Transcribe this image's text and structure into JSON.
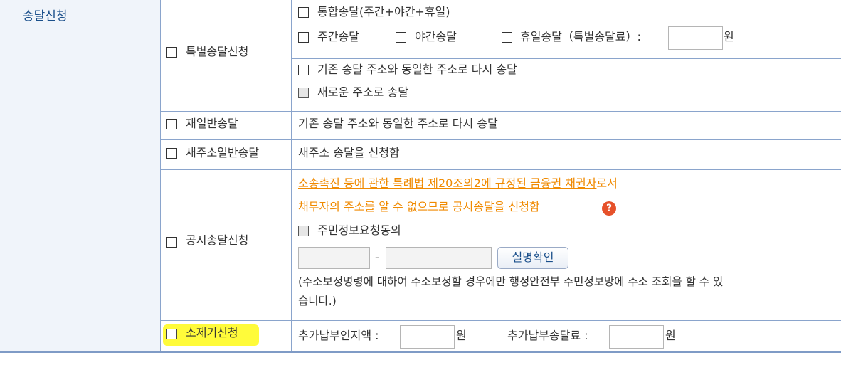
{
  "section_label": "송달신청",
  "special": {
    "label": "특별송달신청",
    "options": {
      "integrated": "통합송달(주간+야간+휴일)",
      "day": "주간송달",
      "night": "야간송달",
      "holiday": "휴일송달（특별송달료）:",
      "holiday_fee_unit": "원",
      "same_address": "기존 송달 주소와 동일한 주소로 다시 송달",
      "new_address": "새로운 주소로 송달"
    }
  },
  "redelivery": {
    "label": "재일반송달",
    "description": "기존 송달 주소와 동일한 주소로 다시 송달"
  },
  "new_address_delivery": {
    "label": "새주소일반송달",
    "description": "새주소 송달을 신청함"
  },
  "public_notice": {
    "label": "공시송달신청",
    "link_text": "소송촉진 등에 관한 특례법 제20조의2에 규정된 금융권 채권자",
    "link_suffix": "로서",
    "notice": "채무자의 주소를 알 수 없으므로 공시송달을 신청함",
    "help_icon": "?",
    "consent_label": "주민정보요청동의",
    "id_separator": "-",
    "verify_button": "실명확인",
    "note_line1": "(주소보정명령에 대하여 주소보정할 경우에만 행정안전부 주민정보망에 주소 조회을 할 수 있",
    "note_line2": "습니다.)"
  },
  "extinguish": {
    "label": "소제기신청",
    "stamp_label": "추가납부인지액 :",
    "stamp_unit": "원",
    "fee_label": "추가납부송달료 :",
    "fee_unit": "원"
  },
  "colors": {
    "border": "#8aa4cc",
    "header_text": "#1a4f8b",
    "link_orange": "#f08a00",
    "highlight": "#fffb3a"
  }
}
